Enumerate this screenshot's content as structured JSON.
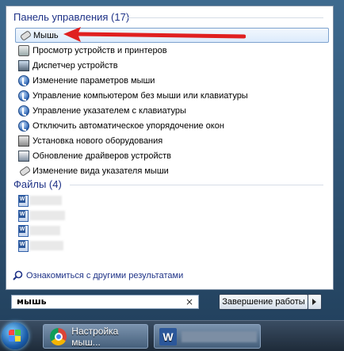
{
  "control_panel": {
    "header": "Панель управления (17)",
    "items": [
      {
        "label": "Мышь",
        "icon": "mouse-icon"
      },
      {
        "label": "Просмотр устройств и принтеров",
        "icon": "printer-icon"
      },
      {
        "label": "Диспетчер устройств",
        "icon": "device-manager-icon"
      },
      {
        "label": "Изменение параметров мыши",
        "icon": "ease-of-access-icon"
      },
      {
        "label": "Управление компьютером без мыши или клавиатуры",
        "icon": "ease-of-access-icon"
      },
      {
        "label": "Управление указателем с клавиатуры",
        "icon": "ease-of-access-icon"
      },
      {
        "label": "Отключить автоматическое упорядочение окон",
        "icon": "ease-of-access-icon"
      },
      {
        "label": "Установка нового оборудования",
        "icon": "hardware-install-icon"
      },
      {
        "label": "Обновление драйверов устройств",
        "icon": "driver-update-icon"
      },
      {
        "label": "Изменение вида указателя мыши",
        "icon": "mouse-icon"
      }
    ]
  },
  "files": {
    "header": "Файлы (4)"
  },
  "more_results": "Ознакомиться с другими результатами",
  "search": {
    "value": "мышь",
    "clear": "×"
  },
  "shutdown_label": "Завершение работы",
  "taskbar": {
    "chrome_title": "Настройка мыш..."
  },
  "colors": {
    "arrow": "#e02020",
    "header_text": "#1e3287",
    "selection": "#dcebfc"
  }
}
